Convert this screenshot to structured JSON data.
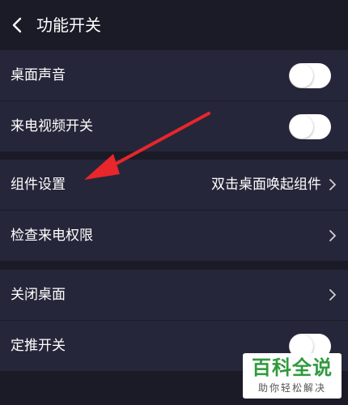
{
  "header": {
    "back_icon": "chevron-left-icon",
    "title": "功能开关"
  },
  "rows": [
    {
      "label": "桌面声音",
      "control": "toggle",
      "toggle_on": false
    },
    {
      "label": "来电视频开关",
      "control": "toggle",
      "toggle_on": false
    },
    {
      "label": "组件设置",
      "value": "双击桌面唤起组件",
      "control": "chevron"
    },
    {
      "label": "检查来电权限",
      "control": "chevron"
    },
    {
      "label": "关闭桌面",
      "control": "chevron"
    },
    {
      "label": "定推开关",
      "control": "toggle",
      "toggle_on": false
    }
  ],
  "annotation": {
    "color": "#e8262b"
  },
  "watermark": {
    "main": "百科全说",
    "sub": "助你轻松解决"
  },
  "colors": {
    "background": "#1b1a27",
    "row": "#26263a",
    "toggle_off": "#ffffff"
  }
}
